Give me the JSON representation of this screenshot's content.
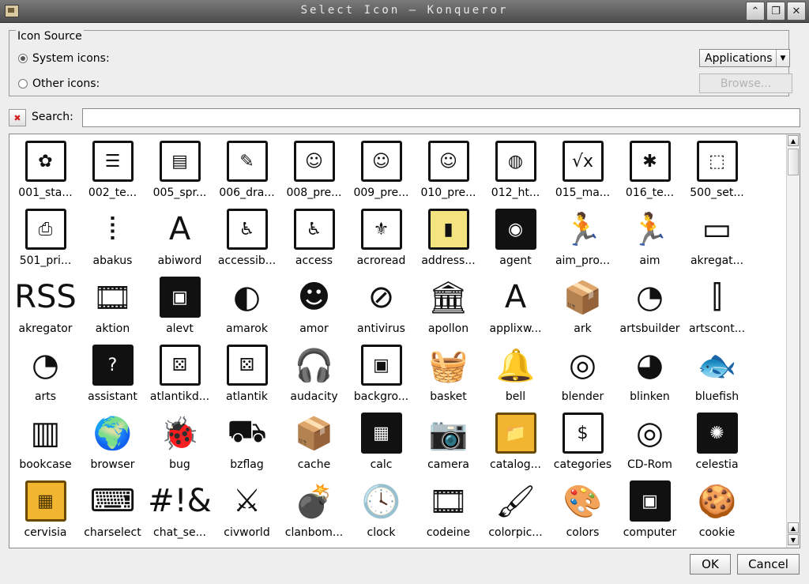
{
  "window": {
    "title": "Select Icon – Konqueror",
    "buttons": {
      "shade": "⌃",
      "maximize": "❐",
      "close": "✕"
    }
  },
  "source": {
    "legend": "Icon Source",
    "system_label": "System icons:",
    "other_label": "Other icons:",
    "system_checked": true,
    "combo_value": "Applications",
    "combo_arrow": "▼",
    "browse_label": "Browse..."
  },
  "search": {
    "label": "Search:",
    "value": "",
    "clear_glyph": "✖"
  },
  "icons": [
    {
      "label": "001_sta...",
      "glyph": "✿",
      "style": "bordered",
      "icon": "butterfly-icon"
    },
    {
      "label": "002_te...",
      "glyph": "☰",
      "style": "bordered",
      "icon": "text-document-icon"
    },
    {
      "label": "005_spr...",
      "glyph": "▤",
      "style": "bordered",
      "icon": "spreadsheet-icon"
    },
    {
      "label": "006_dra...",
      "glyph": "✎",
      "style": "bordered",
      "icon": "drawing-pencil-icon"
    },
    {
      "label": "008_pre...",
      "glyph": "☺",
      "style": "bordered",
      "icon": "presenter-icon"
    },
    {
      "label": "009_pre...",
      "glyph": "☺",
      "style": "bordered",
      "icon": "presenter-icon"
    },
    {
      "label": "010_pre...",
      "glyph": "☺",
      "style": "bordered",
      "icon": "presenter-icon"
    },
    {
      "label": "012_ht...",
      "glyph": "◍",
      "style": "bordered",
      "icon": "globe-document-icon"
    },
    {
      "label": "015_ma...",
      "glyph": "√x",
      "style": "bordered",
      "icon": "math-formula-icon"
    },
    {
      "label": "016_te...",
      "glyph": "✱",
      "style": "bordered",
      "icon": "asterisk-icon"
    },
    {
      "label": "500_set...",
      "glyph": "⬚",
      "style": "bordered",
      "icon": "open-box-icon"
    },
    {
      "label": "501_pri...",
      "glyph": "⎙",
      "style": "bordered",
      "icon": "printer-icon"
    },
    {
      "label": "abakus",
      "glyph": "⦙",
      "style": "bare",
      "icon": "abacus-icon"
    },
    {
      "label": "abiword",
      "glyph": "A",
      "style": "bare",
      "icon": "abiword-icon"
    },
    {
      "label": "accessib...",
      "glyph": "♿",
      "style": "bordered",
      "icon": "accessibility-icon"
    },
    {
      "label": "access",
      "glyph": "♿",
      "style": "bordered",
      "icon": "accessibility-icon"
    },
    {
      "label": "acroread",
      "glyph": "⚜",
      "style": "bordered",
      "icon": "acrobat-icon"
    },
    {
      "label": "address...",
      "glyph": "▮",
      "style": "yellow",
      "icon": "address-book-icon"
    },
    {
      "label": "agent",
      "glyph": "◉",
      "style": "dark",
      "icon": "agent-icon"
    },
    {
      "label": "aim_pro...",
      "glyph": "🏃",
      "style": "bare",
      "icon": "running-man-icon"
    },
    {
      "label": "aim",
      "glyph": "🏃",
      "style": "bare",
      "icon": "running-man-icon"
    },
    {
      "label": "akregat...",
      "glyph": "▭",
      "style": "bare",
      "icon": "feed-reader-icon"
    },
    {
      "label": "akregator",
      "glyph": "RSS",
      "style": "bare",
      "icon": "rss-icon"
    },
    {
      "label": "aktion",
      "glyph": "🎞",
      "style": "bare",
      "icon": "film-strip-icon"
    },
    {
      "label": "alevt",
      "glyph": "▣",
      "style": "dark",
      "icon": "monitor-icon"
    },
    {
      "label": "amarok",
      "glyph": "◐",
      "style": "bare",
      "icon": "speaker-icon"
    },
    {
      "label": "amor",
      "glyph": "☻",
      "style": "bare",
      "icon": "smiley-icon"
    },
    {
      "label": "antivirus",
      "glyph": "⊘",
      "style": "bare",
      "icon": "antivirus-icon"
    },
    {
      "label": "apollon",
      "glyph": "🏛",
      "style": "bare",
      "icon": "temple-icon"
    },
    {
      "label": "applixw...",
      "glyph": "A",
      "style": "bare",
      "icon": "letter-a-icon"
    },
    {
      "label": "ark",
      "glyph": "📦",
      "style": "bare",
      "icon": "archive-box-icon"
    },
    {
      "label": "artsbuilder",
      "glyph": "◔",
      "style": "bare",
      "icon": "speaker-icon"
    },
    {
      "label": "artscont...",
      "glyph": "⫿",
      "style": "bare",
      "icon": "mixer-sliders-icon"
    },
    {
      "label": "arts",
      "glyph": "◔",
      "style": "bare",
      "icon": "speaker-icon"
    },
    {
      "label": "assistant",
      "glyph": "?",
      "style": "dark",
      "icon": "question-bubble-icon"
    },
    {
      "label": "atlantikd...",
      "glyph": "⚄",
      "style": "bordered",
      "icon": "dice-board-icon"
    },
    {
      "label": "atlantik",
      "glyph": "⚄",
      "style": "bordered",
      "icon": "dice-board-icon"
    },
    {
      "label": "audacity",
      "glyph": "🎧",
      "style": "bare",
      "icon": "headphones-icon"
    },
    {
      "label": "backgro...",
      "glyph": "▣",
      "style": "bordered",
      "icon": "monitor-picture-icon"
    },
    {
      "label": "basket",
      "glyph": "🧺",
      "style": "bare",
      "icon": "basket-icon"
    },
    {
      "label": "bell",
      "glyph": "🔔",
      "style": "bare",
      "icon": "bell-icon"
    },
    {
      "label": "blender",
      "glyph": "◎",
      "style": "bare",
      "icon": "blender-icon"
    },
    {
      "label": "blinken",
      "glyph": "◕",
      "style": "bare",
      "icon": "blinken-icon"
    },
    {
      "label": "bluefish",
      "glyph": "🐟",
      "style": "bare",
      "icon": "fish-icon"
    },
    {
      "label": "bookcase",
      "glyph": "▥",
      "style": "bare",
      "icon": "bookcase-icon"
    },
    {
      "label": "browser",
      "glyph": "🌍",
      "style": "bare",
      "icon": "globe-icon"
    },
    {
      "label": "bug",
      "glyph": "🐞",
      "style": "bare",
      "icon": "bug-icon"
    },
    {
      "label": "bzflag",
      "glyph": "⛟",
      "style": "bare",
      "icon": "tank-icon"
    },
    {
      "label": "cache",
      "glyph": "📦",
      "style": "bare",
      "icon": "open-box-icon"
    },
    {
      "label": "calc",
      "glyph": "▦",
      "style": "dark",
      "icon": "calculator-icon"
    },
    {
      "label": "camera",
      "glyph": "📷",
      "style": "bare",
      "icon": "camera-icon"
    },
    {
      "label": "catalog...",
      "glyph": "📁",
      "style": "amber",
      "icon": "folder-wand-icon"
    },
    {
      "label": "categories",
      "glyph": "$",
      "style": "bordered",
      "icon": "categories-icon"
    },
    {
      "label": "CD-Rom",
      "glyph": "◎",
      "style": "bare",
      "icon": "cd-rom-icon"
    },
    {
      "label": "celestia",
      "glyph": "✺",
      "style": "dark",
      "icon": "celestia-icon"
    },
    {
      "label": "cervisia",
      "glyph": "▦",
      "style": "amber",
      "icon": "brick-wall-icon"
    },
    {
      "label": "charselect",
      "glyph": "⌨",
      "style": "bare",
      "icon": "ctrl-alt-keys-icon"
    },
    {
      "label": "chat_se...",
      "glyph": "#!&",
      "style": "bare",
      "icon": "chat-bubble-icon"
    },
    {
      "label": "civworld",
      "glyph": "⚔",
      "style": "bare",
      "icon": "shield-sword-icon"
    },
    {
      "label": "clanbom...",
      "glyph": "💣",
      "style": "bare",
      "icon": "bomb-icon"
    },
    {
      "label": "clock",
      "glyph": "🕓",
      "style": "bare",
      "icon": "clock-icon"
    },
    {
      "label": "codeine",
      "glyph": "🎞",
      "style": "bare",
      "icon": "film-strip-icon"
    },
    {
      "label": "colorpic...",
      "glyph": "🖌",
      "style": "bare",
      "icon": "color-picker-icon"
    },
    {
      "label": "colors",
      "glyph": "🎨",
      "style": "bare",
      "icon": "palette-icon"
    },
    {
      "label": "computer",
      "glyph": "▣",
      "style": "dark",
      "icon": "computer-icon"
    },
    {
      "label": "cookie",
      "glyph": "🍪",
      "style": "bare",
      "icon": "cookie-icon"
    }
  ],
  "buttons": {
    "ok": "OK",
    "cancel": "Cancel"
  },
  "scrollbar": {
    "up": "▲",
    "down": "▼"
  }
}
